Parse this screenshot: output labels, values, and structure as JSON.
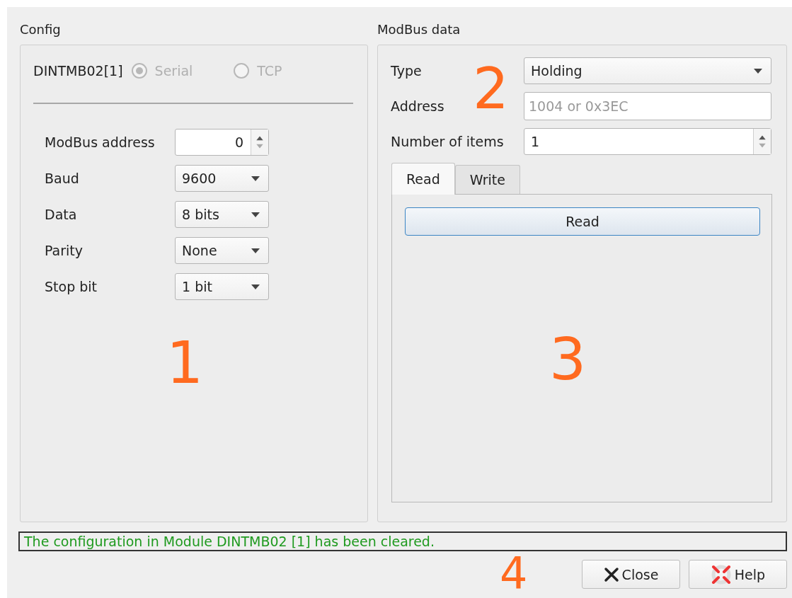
{
  "config": {
    "title": "Config",
    "device": "DINTMB02[1]",
    "marker": "1",
    "radios": [
      {
        "label": "Serial",
        "selected": true,
        "disabled": true
      },
      {
        "label": "TCP",
        "selected": false,
        "disabled": true
      }
    ],
    "fields": [
      {
        "kind": "spin",
        "label": "ModBus address",
        "value": "0"
      },
      {
        "kind": "combo",
        "label": "Baud",
        "value": "9600"
      },
      {
        "kind": "combo",
        "label": "Data",
        "value": "8 bits"
      },
      {
        "kind": "combo",
        "label": "Parity",
        "value": "None"
      },
      {
        "kind": "combo",
        "label": "Stop bit",
        "value": "1 bit"
      }
    ]
  },
  "modbus": {
    "title": "ModBus data",
    "marker": "2",
    "panel_marker": "3",
    "fields": [
      {
        "kind": "combo",
        "label": "Type",
        "value": "Holding"
      },
      {
        "kind": "text",
        "label": "Address",
        "placeholder": "1004 or 0x3EC"
      },
      {
        "kind": "spin",
        "label": "Number of items",
        "value": "1"
      }
    ],
    "tabs": [
      {
        "label": "Read",
        "selected": true
      },
      {
        "label": "Write",
        "selected": false
      }
    ],
    "read_button": "Read"
  },
  "status": {
    "message": "The configuration in Module DINTMB02 [1] has been cleared.",
    "marker": "4"
  },
  "buttons": [
    {
      "kind": "close",
      "label": "Close"
    },
    {
      "kind": "help",
      "label": "Help"
    }
  ]
}
